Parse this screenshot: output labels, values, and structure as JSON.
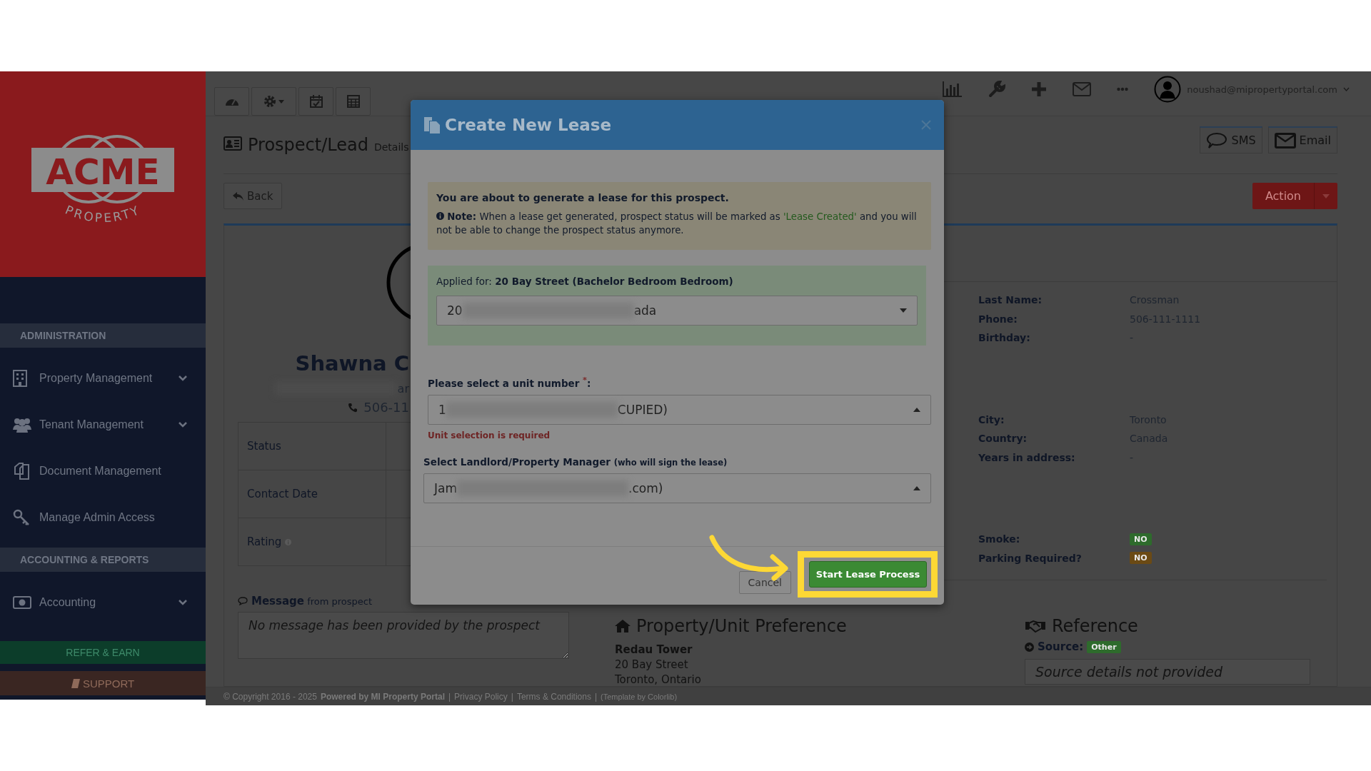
{
  "sidebar": {
    "logo": {
      "name": "ACME",
      "tagline": "PROPERTY"
    },
    "sections": [
      {
        "title": "ADMINISTRATION",
        "items": [
          {
            "label": "Property Management",
            "expandable": true
          },
          {
            "label": "Tenant Management",
            "expandable": true
          },
          {
            "label": "Document Management",
            "expandable": false
          },
          {
            "label": "Manage Admin Access",
            "expandable": false
          }
        ]
      },
      {
        "title": "ACCOUNTING & REPORTS",
        "items": [
          {
            "label": "Accounting",
            "expandable": true
          }
        ]
      }
    ],
    "refer_button": "REFER & EARN",
    "support_button": "SUPPORT"
  },
  "topbar": {
    "user_email": "noushad@mipropertyportal.com"
  },
  "page": {
    "title": "Prospect/Lead",
    "subtitle": "Details",
    "back_button": "Back",
    "sms_button": "SMS",
    "email_button": "Email",
    "action_button": "Action"
  },
  "profile": {
    "name": "Shawna C",
    "email_fragment": "ar",
    "phone": "506-11",
    "table_rows": [
      "Status",
      "Contact Date",
      "Rating"
    ],
    "message_label": "**Message** from prospect",
    "message_placeholder": "No message has been provided by the prospect"
  },
  "details": [
    {
      "rows": [
        {
          "label": "Last Name:",
          "value": "Crossman"
        },
        {
          "label": "Phone:",
          "value": "506-111-1111"
        },
        {
          "label": "Birthday:",
          "value": "-"
        }
      ]
    },
    {
      "rows": [
        {
          "label": "City:",
          "value": "Toronto"
        },
        {
          "label": "Country:",
          "value": "Canada"
        },
        {
          "label": "Years in address:",
          "value": "-"
        }
      ]
    },
    {
      "rows": [
        {
          "label": "Smoke:",
          "value": "NO",
          "kind": "badge",
          "color": "#2e6b2c"
        },
        {
          "label": "Parking Required?",
          "value": "NO",
          "kind": "badge",
          "color": "#6b4a14"
        }
      ]
    }
  ],
  "property_preference": {
    "heading": "Property/Unit Preference",
    "lines": [
      "Redau Tower",
      "20 Bay Street",
      "Toronto, Ontario"
    ]
  },
  "reference": {
    "heading": "Reference",
    "source_label": "Source:",
    "source_badge": "Other",
    "placeholder": "Source details not provided"
  },
  "footer": [
    {
      "kind": "text",
      "text": "© Copyright 2016 - 2025"
    },
    {
      "kind": "bold",
      "text": "Powered by MI Property Portal"
    },
    {
      "kind": "separator",
      "text": "|"
    },
    {
      "kind": "link",
      "text": "Privacy Policy"
    },
    {
      "kind": "separator",
      "text": "|"
    },
    {
      "kind": "link",
      "text": "Terms & Conditions"
    },
    {
      "kind": "separator",
      "text": "|"
    },
    {
      "kind": "small",
      "text": "(Template by Colorlib)"
    }
  ],
  "modal": {
    "title": "Create New Lease",
    "intro": "You are about to generate a lease for this prospect.",
    "note_before": "**Note:** When a lease get generated, prospect status will be marked as ",
    "note_highlight": "'Lease Created'",
    "note_after": " and you will not be able to change the prospect status anymore.",
    "applied_for": "Applied for: **20 Bay Street (Bachelor Bedroom Bedroom)**",
    "property_select": {
      "value_start": "20",
      "value_end": "ada",
      "expanded": false
    },
    "unit_label": "Please select a unit number $^{*}$:",
    "unit_select": {
      "value_start": "1",
      "value_end": "CUPIED)",
      "expanded": true
    },
    "unit_error": "Unit selection is required",
    "landlord_label": "Select Landlord/Property Manager",
    "landlord_hint": "(who will sign the lease)",
    "landlord_select": {
      "value_start": "Jam",
      "value_end": ".com)",
      "expanded": true
    },
    "cancel_button": "Cancel",
    "submit_button": "Start Lease Process",
    "submit_highlighted": true
  }
}
